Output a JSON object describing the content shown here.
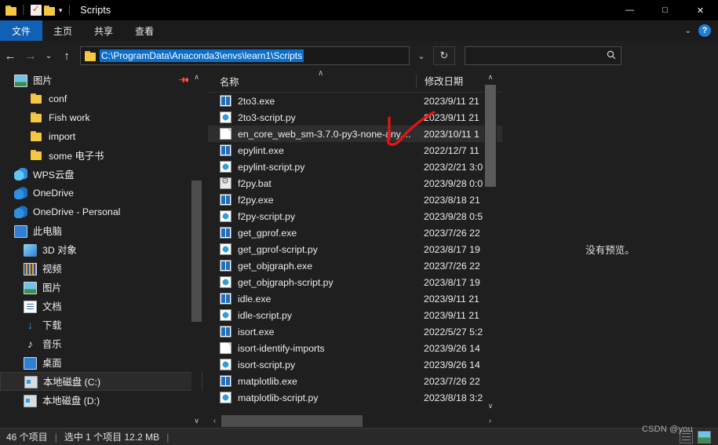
{
  "window": {
    "title": "Scripts",
    "quick_access": [
      "folder-icon",
      "properties-icon",
      "new-folder-icon",
      "customize-caret-icon"
    ],
    "minimize": "—",
    "maximize": "□",
    "close": "✕"
  },
  "ribbon": {
    "tabs": [
      {
        "label": "文件",
        "active": true
      },
      {
        "label": "主页",
        "active": false
      },
      {
        "label": "共享",
        "active": false
      },
      {
        "label": "查看",
        "active": false
      }
    ],
    "collapse_caret": "⌄",
    "help_label": "?"
  },
  "nav": {
    "back": "←",
    "forward": "→",
    "recent": "⌄",
    "up": "↑",
    "address_value": "C:\\ProgramData\\Anaconda3\\envs\\learn1\\Scripts",
    "address_history_caret": "⌄",
    "refresh": "↻",
    "search_placeholder": "",
    "search_value": "",
    "search_icon": "⌕"
  },
  "sidebar": {
    "items": [
      {
        "label": "图片",
        "icon": "picture-icon",
        "indent": 0,
        "pinned": true
      },
      {
        "label": "conf",
        "icon": "folder-icon",
        "indent": 1
      },
      {
        "label": "Fish work",
        "icon": "folder-icon",
        "indent": 1
      },
      {
        "label": "import",
        "icon": "folder-icon",
        "indent": 1
      },
      {
        "label": "some 电子书",
        "icon": "folder-icon",
        "indent": 1
      },
      {
        "label": "WPS云盘",
        "icon": "cloud-icon",
        "indent": 0
      },
      {
        "label": "OneDrive",
        "icon": "cloud-icon",
        "indent": 0
      },
      {
        "label": "OneDrive - Personal",
        "icon": "cloud-icon",
        "indent": 0
      },
      {
        "label": "此电脑",
        "icon": "computer-icon",
        "indent": 0
      },
      {
        "label": "3D 对象",
        "icon": "3d-icon",
        "indent": 2
      },
      {
        "label": "视频",
        "icon": "video-icon",
        "indent": 2
      },
      {
        "label": "图片",
        "icon": "picture-icon",
        "indent": 2
      },
      {
        "label": "文档",
        "icon": "document-icon",
        "indent": 2
      },
      {
        "label": "下载",
        "icon": "download-icon",
        "indent": 2
      },
      {
        "label": "音乐",
        "icon": "music-icon",
        "indent": 2
      },
      {
        "label": "桌面",
        "icon": "desktop-icon",
        "indent": 2
      },
      {
        "label": "本地磁盘 (C:)",
        "icon": "disk-icon",
        "indent": 2,
        "hover": true
      },
      {
        "label": "本地磁盘 (D:)",
        "icon": "disk-icon",
        "indent": 2
      }
    ],
    "scroll_up": "∧",
    "scroll_down": "∨"
  },
  "filelist": {
    "columns": [
      {
        "label": "名称",
        "sorted": true,
        "sort_caret": "∧"
      },
      {
        "label": "修改日期"
      }
    ],
    "rows": [
      {
        "name": "2to3.exe",
        "icon": "exe-icon",
        "date": "2023/9/11 21",
        "selected": false
      },
      {
        "name": "2to3-script.py",
        "icon": "py-icon",
        "date": "2023/9/11 21",
        "selected": false
      },
      {
        "name": "en_core_web_sm-3.7.0-py3-none-any....",
        "icon": "blank-icon",
        "date": "2023/10/11 1",
        "selected": true
      },
      {
        "name": "epylint.exe",
        "icon": "exe-icon",
        "date": "2022/12/7 11",
        "selected": false
      },
      {
        "name": "epylint-script.py",
        "icon": "py-icon",
        "date": "2023/2/21 3:0",
        "selected": false
      },
      {
        "name": "f2py.bat",
        "icon": "bat-icon",
        "date": "2023/9/28 0:0",
        "selected": false
      },
      {
        "name": "f2py.exe",
        "icon": "exe-icon",
        "date": "2023/8/18 21",
        "selected": false
      },
      {
        "name": "f2py-script.py",
        "icon": "py-icon",
        "date": "2023/9/28 0:5",
        "selected": false
      },
      {
        "name": "get_gprof.exe",
        "icon": "exe-icon",
        "date": "2023/7/26 22",
        "selected": false
      },
      {
        "name": "get_gprof-script.py",
        "icon": "py-icon",
        "date": "2023/8/17 19",
        "selected": false
      },
      {
        "name": "get_objgraph.exe",
        "icon": "exe-icon",
        "date": "2023/7/26 22",
        "selected": false
      },
      {
        "name": "get_objgraph-script.py",
        "icon": "py-icon",
        "date": "2023/8/17 19",
        "selected": false
      },
      {
        "name": "idle.exe",
        "icon": "exe-icon",
        "date": "2023/9/11 21",
        "selected": false
      },
      {
        "name": "idle-script.py",
        "icon": "py-icon",
        "date": "2023/9/11 21",
        "selected": false
      },
      {
        "name": "isort.exe",
        "icon": "exe-icon",
        "date": "2022/5/27 5:2",
        "selected": false
      },
      {
        "name": "isort-identify-imports",
        "icon": "blank-icon",
        "date": "2023/9/26 14",
        "selected": false
      },
      {
        "name": "isort-script.py",
        "icon": "py-icon",
        "date": "2023/9/26 14",
        "selected": false
      },
      {
        "name": "matplotlib.exe",
        "icon": "exe-icon",
        "date": "2023/7/26 22",
        "selected": false
      },
      {
        "name": "matplotlib-script.py",
        "icon": "py-icon",
        "date": "2023/8/18 3:2",
        "selected": false
      }
    ],
    "scroll_up": "∧",
    "scroll_down": "∨",
    "scroll_left": "‹",
    "scroll_right": "›"
  },
  "preview": {
    "message": "没有预览。"
  },
  "status": {
    "item_count": "46 个项目",
    "separator1": "|",
    "selection": "选中 1 个项目  12.2 MB",
    "separator2": "|"
  },
  "watermark": {
    "text": "CSDN @you"
  },
  "colors": {
    "accent_blue": "#1060b5",
    "selection_blue": "#0b6ecb",
    "window_bg": "#1f1f1f",
    "titlebar_bg": "#000000",
    "annotation_red": "#e81313",
    "folder_yellow": "#f5c843"
  }
}
